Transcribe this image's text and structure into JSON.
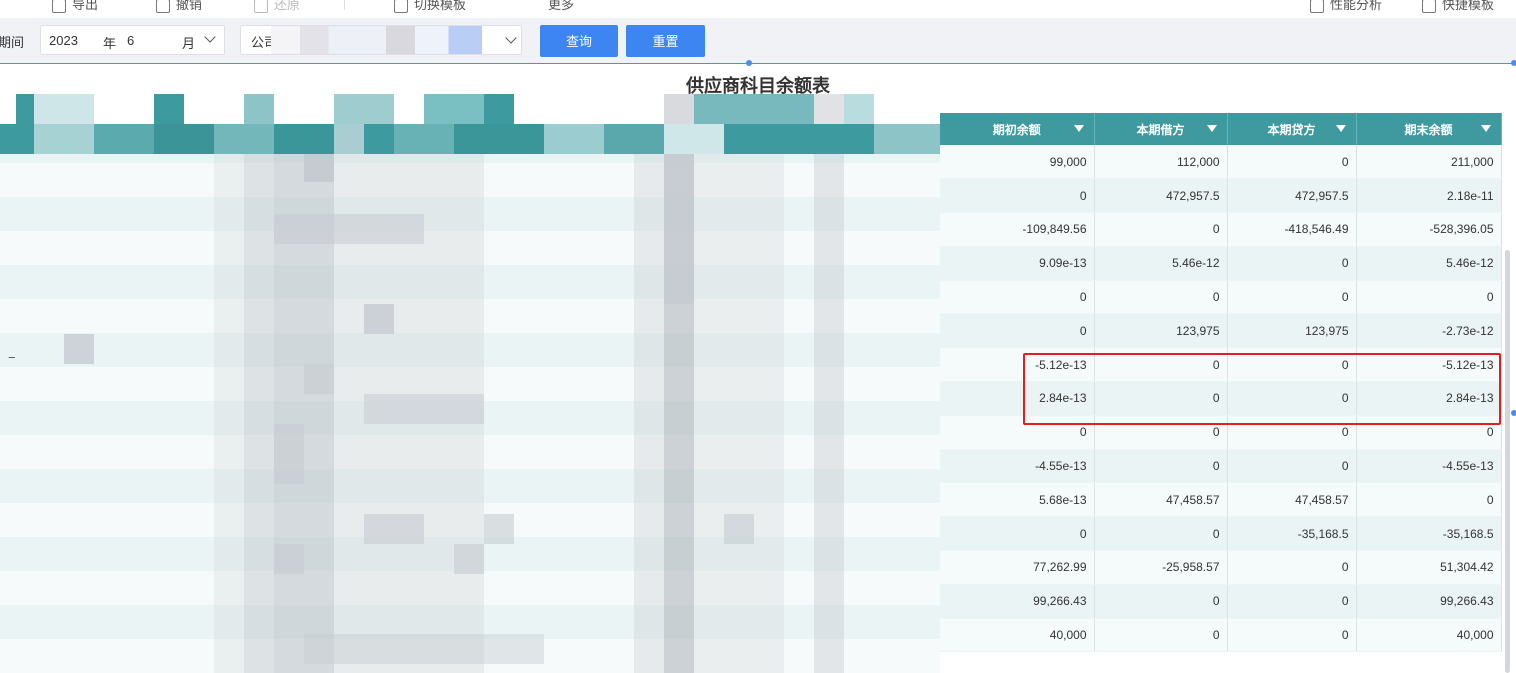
{
  "toolbar": {
    "items": [
      {
        "label": "导出"
      },
      {
        "label": "撤销"
      },
      {
        "label": "还原"
      },
      {
        "label": "切换模板"
      },
      {
        "label": "更多"
      },
      {
        "label": "性能分析"
      },
      {
        "label": "快捷模板"
      }
    ]
  },
  "filters": {
    "period_label": "期间",
    "year_value": "2023",
    "year_unit": "年",
    "month_value": "6",
    "month_unit": "月",
    "company_label": "公司",
    "query_label": "查询",
    "reset_label": "重置"
  },
  "report": {
    "title": "供应商科目余额表"
  },
  "table": {
    "columns": [
      "期初余额",
      "本期借方",
      "本期贷方",
      "期末余额"
    ],
    "rows": [
      [
        "99,000",
        "112,000",
        "0",
        "211,000"
      ],
      [
        "0",
        "472,957.5",
        "472,957.5",
        "2.18e-11"
      ],
      [
        "-109,849.56",
        "0",
        "-418,546.49",
        "-528,396.05"
      ],
      [
        "9.09e-13",
        "5.46e-12",
        "0",
        "5.46e-12"
      ],
      [
        "0",
        "0",
        "0",
        "0"
      ],
      [
        "0",
        "123,975",
        "123,975",
        "-2.73e-12"
      ],
      [
        "-5.12e-13",
        "0",
        "0",
        "-5.12e-13"
      ],
      [
        "2.84e-13",
        "0",
        "0",
        "2.84e-13"
      ],
      [
        "0",
        "0",
        "0",
        "0"
      ],
      [
        "-4.55e-13",
        "0",
        "0",
        "-4.55e-13"
      ],
      [
        "5.68e-13",
        "47,458.57",
        "47,458.57",
        "0"
      ],
      [
        "0",
        "0",
        "-35,168.5",
        "-35,168.5"
      ],
      [
        "77,262.99",
        "-25,958.57",
        "0",
        "51,304.42"
      ],
      [
        "99,266.43",
        "0",
        "0",
        "99,266.43"
      ],
      [
        "40,000",
        "0",
        "0",
        "40,000"
      ]
    ]
  },
  "colors": {
    "header_teal": "#3e9a9f",
    "primary_button": "#3d85f0",
    "highlight_red": "#e02020"
  }
}
